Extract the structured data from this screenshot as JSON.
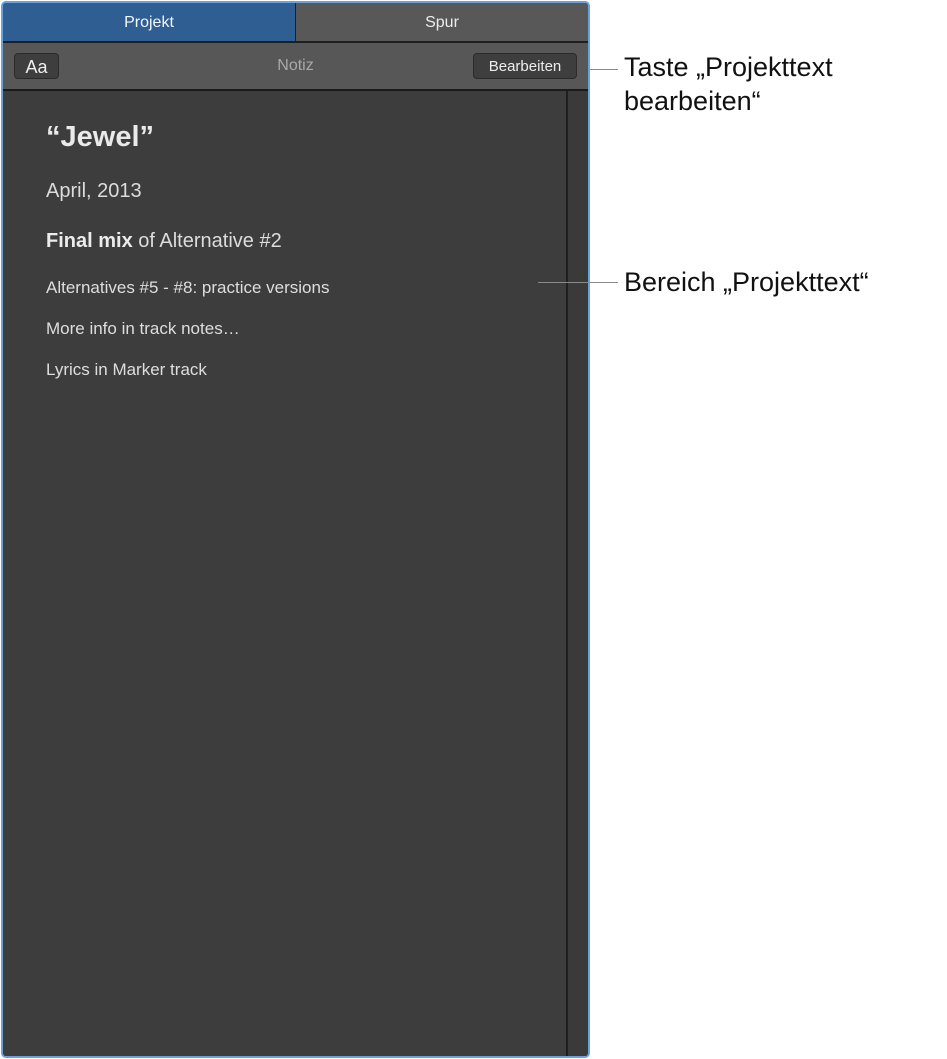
{
  "tabs": [
    {
      "label": "Projekt",
      "active": true
    },
    {
      "label": "Spur",
      "active": false
    }
  ],
  "toolbar": {
    "font_button_label": "Aa",
    "title": "Notiz",
    "edit_button_label": "Bearbeiten"
  },
  "notes": {
    "title": "“Jewel”",
    "date": "April, 2013",
    "mix_bold": "Final mix",
    "mix_rest": " of Alternative #2",
    "line_alternatives": "Alternatives #5 - #8: practice versions",
    "line_more_info": "More info in track notes…",
    "line_lyrics": "Lyrics in Marker track"
  },
  "callouts": {
    "edit_button_line1": "Taste „Projekttext",
    "edit_button_line2": "bearbeiten“",
    "text_area": "Bereich „Projekttext“"
  },
  "colors": {
    "active_tab": "#2f5e93",
    "panel_border": "#6aa2d9",
    "panel_background": "#3d3d3d",
    "toolbar_background": "#575757"
  }
}
